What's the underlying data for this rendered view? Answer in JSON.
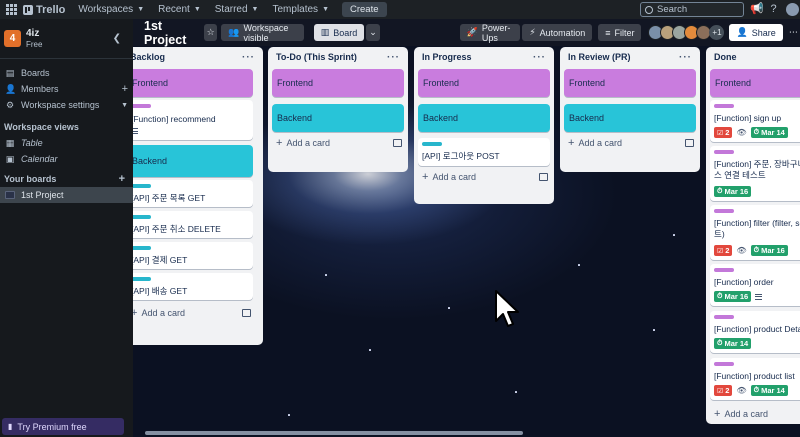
{
  "topnav": {
    "logo": "Trello",
    "menus": [
      "Workspaces",
      "Recent",
      "Starred",
      "Templates"
    ],
    "create": "Create",
    "search_placeholder": "Search"
  },
  "sidebar": {
    "workspace_badge": "4",
    "workspace_name": "4iz",
    "workspace_plan": "Free",
    "items": [
      {
        "label": "Boards",
        "icon": "board-icon"
      },
      {
        "label": "Members",
        "icon": "members-icon"
      },
      {
        "label": "Workspace settings",
        "icon": "gear-icon"
      }
    ],
    "views_title": "Workspace views",
    "views": [
      {
        "label": "Table",
        "icon": "table-icon"
      },
      {
        "label": "Calendar",
        "icon": "calendar-icon"
      }
    ],
    "boards_title": "Your boards",
    "boards": [
      {
        "label": "1st Project"
      }
    ],
    "premium": "Try Premium free"
  },
  "board": {
    "title": "1st Project",
    "visibility": "Workspace visible",
    "view": "Board",
    "powerups": "Power-Ups",
    "automation": "Automation",
    "filter": "Filter",
    "member_more": "+1",
    "share": "Share"
  },
  "lists": {
    "backlog": {
      "title": "Backlog",
      "cover1": "Frontend",
      "card1": "[Function] recommend",
      "cover2": "Backend",
      "card2": "[API] 주문 목록 GET",
      "card3": "[API] 주문 취소 DELETE",
      "card4": "[API] 결제 GET",
      "card5": "[API] 배송 GET",
      "add": "Add a card"
    },
    "todo": {
      "title": "To-Do (This Sprint)",
      "cover1": "Frontend",
      "cover2": "Backend",
      "add": "Add a card"
    },
    "inprogress": {
      "title": "In Progress",
      "cover1": "Frontend",
      "cover2": "Backend",
      "card1": "[API] 로그아웃 POST",
      "add": "Add a card"
    },
    "review": {
      "title": "In Review (PR)",
      "cover1": "Frontend",
      "cover2": "Backend",
      "add": "Add a card"
    },
    "done": {
      "title": "Done",
      "cover1": "Frontend",
      "card1": "[Function] sign up",
      "card1_checks": "2",
      "card1_date": "Mar 14",
      "card2_line1": "[Function] 주문, 장바구니, 결",
      "card2_line2": "스 연결 테스트",
      "card2_date": "Mar 16",
      "card3_line1": "[Function] filter (filter, sor",
      "card3_line2": "트)",
      "card3_checks": "2",
      "card3_date": "Mar 16",
      "card4": "[Function] order",
      "card4_date": "Mar 16",
      "card5": "[Function] product Detail",
      "card5_date": "Mar 14",
      "card6": "[Function] product list",
      "card6_checks": "2",
      "card6_date": "Mar 14",
      "add": "Add a card"
    }
  },
  "colors": {
    "frontend_cover": "#c97cde",
    "backend_cover": "#28c4d8",
    "due_green": "#22a06b",
    "checklist_red": "#e2483d",
    "workspace_badge": "#e2702a"
  }
}
